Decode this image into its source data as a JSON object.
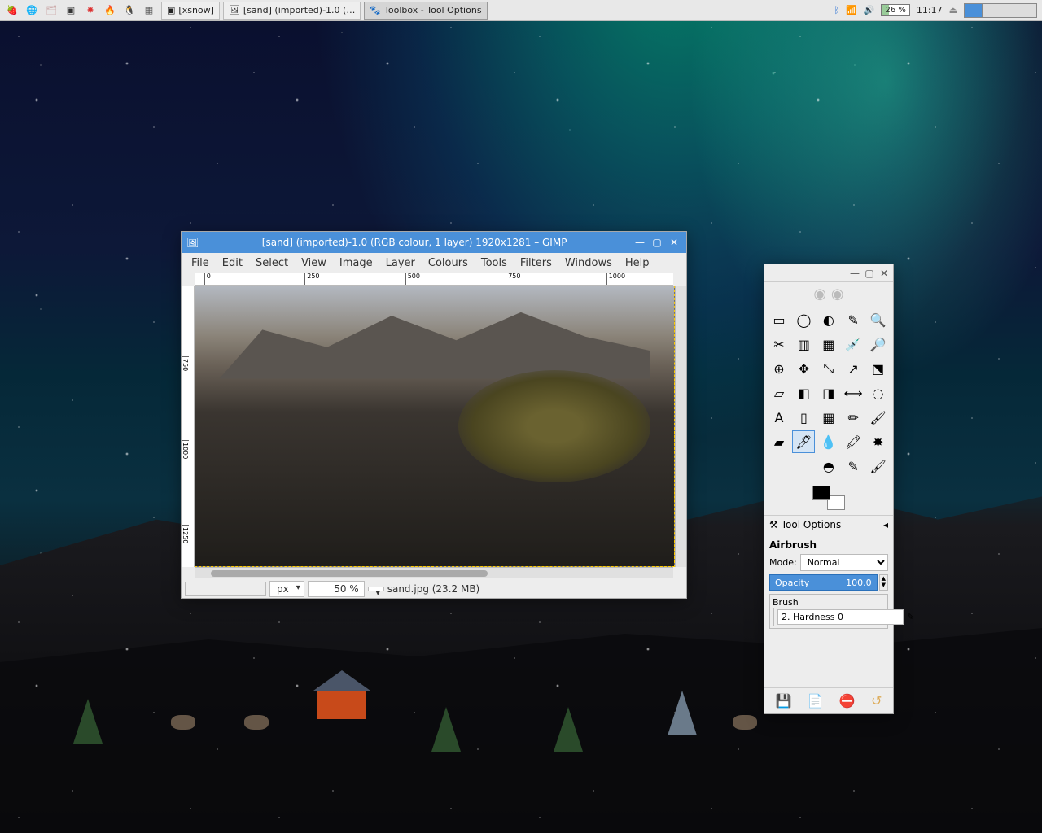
{
  "panel": {
    "tasks": [
      {
        "label": "[xsnow]",
        "icon": "▣"
      },
      {
        "label": "[sand] (imported)-1.0 (…",
        "icon": "🖼"
      },
      {
        "label": "Toolbox - Tool Options",
        "icon": "🐾"
      }
    ],
    "battery": "26 %",
    "clock": "11:17"
  },
  "gimp": {
    "title": "[sand] (imported)-1.0 (RGB colour, 1 layer) 1920x1281 – GIMP",
    "menus": [
      "File",
      "Edit",
      "Select",
      "View",
      "Image",
      "Layer",
      "Colours",
      "Tools",
      "Filters",
      "Windows",
      "Help"
    ],
    "ruler_h": [
      "0",
      "250",
      "500",
      "750",
      "1000"
    ],
    "ruler_v": [
      "750",
      "1000",
      "1250"
    ],
    "units": "px",
    "zoom": "50 %",
    "status": "sand.jpg (23.2 MB)"
  },
  "toolbox": {
    "tool_options_label": "Tool Options",
    "tool_name": "Airbrush",
    "mode_label": "Mode:",
    "mode_value": "Normal",
    "opacity_label": "Opacity",
    "opacity_value": "100.0",
    "brush_label": "Brush",
    "brush_value": "2. Hardness 0",
    "tools": [
      "▭",
      "◯",
      "◐",
      "✎",
      "🔍",
      "✂",
      "▥",
      "▦",
      "💉",
      "🔎",
      "⊕",
      "✥",
      "⤡",
      "↗",
      "⬔",
      "▱",
      "◧",
      "◨",
      "⟷",
      "◌",
      "A",
      "▯",
      "▦",
      "✏",
      "🖌",
      "▰",
      "🖊",
      "💧",
      "🖍",
      "✸",
      "",
      "",
      "◓",
      "✎",
      "🖌"
    ],
    "selected_index": 26
  }
}
